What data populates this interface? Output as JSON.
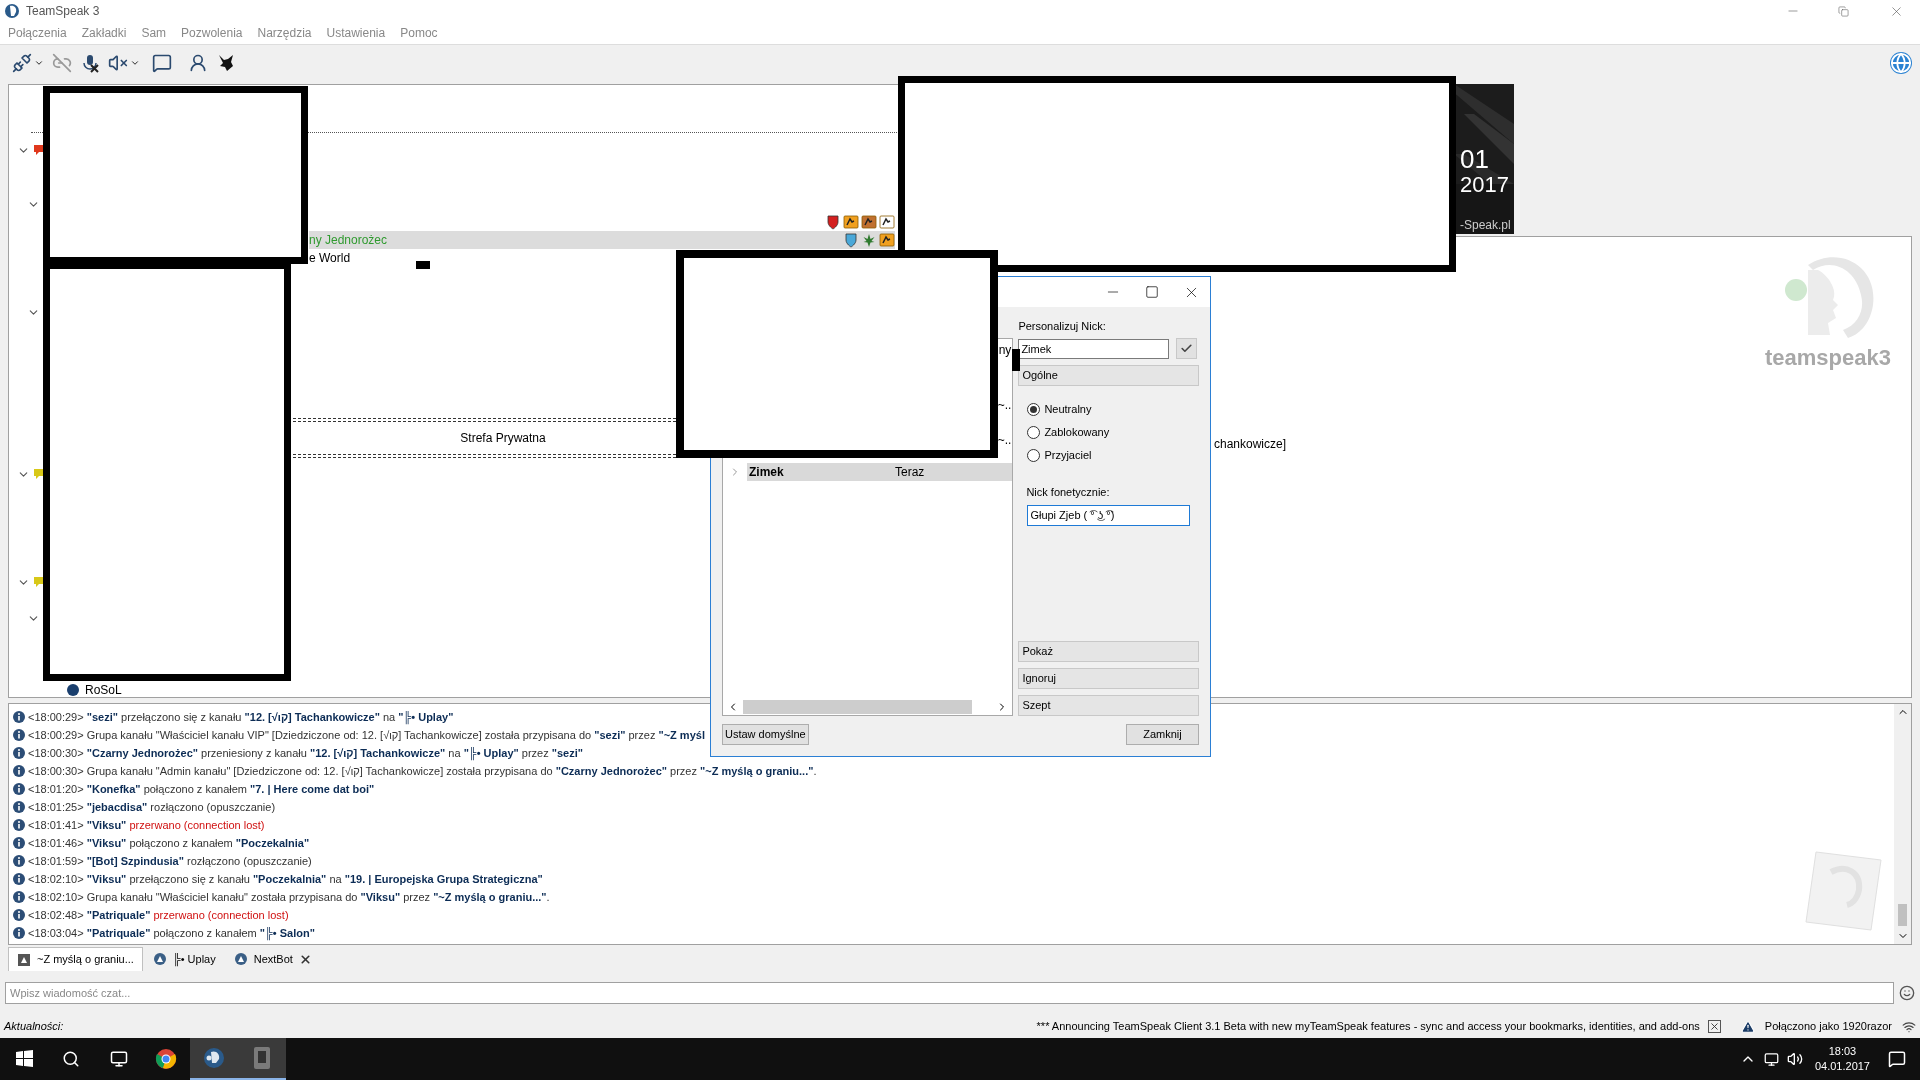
{
  "window": {
    "title": "TeamSpeak 3"
  },
  "menu": [
    "Połączenia",
    "Zakładki",
    "Sam",
    "Pozwolenia",
    "Narzędzia",
    "Ustawienia",
    "Pomoc"
  ],
  "tree": [
    {
      "kind": "dotted-spacer"
    },
    {
      "kind": "channel",
      "expanded": true,
      "color": "#e0381c",
      "children": [
        {
          "kind": "channel",
          "expanded": true,
          "children": [
            {
              "kind": "client"
            },
            {
              "kind": "client",
              "name": "ny Jednorożec",
              "selected": true,
              "color": "#2f9a2f"
            },
            {
              "kind": "client",
              "name": "e World",
              "selected": false,
              "color": "#000000"
            }
          ]
        },
        {
          "kind": "channel",
          "expanded": true
        }
      ]
    },
    {
      "kind": "double-spacer"
    },
    {
      "kind": "title-spacer",
      "name": "Strefa Prywatna"
    },
    {
      "kind": "double-spacer"
    },
    {
      "kind": "channel",
      "expanded": true,
      "color": "#d8c818"
    },
    {
      "kind": "channel",
      "expanded": true,
      "color": "#d8c818",
      "children": [
        {
          "kind": "channel",
          "expanded": true,
          "children": [
            {
              "kind": "client",
              "name": "RoSoL",
              "selected": false,
              "color": "#000000"
            }
          ]
        }
      ]
    }
  ],
  "info": {
    "banner": [
      "01",
      "2017",
      "-Speak.pl"
    ],
    "fragment": "chankowicze]",
    "logo": "teamspeak3"
  },
  "dialog": {
    "label": "Personalizuj Nick:",
    "nick": "Zimek",
    "section": "Ogólne",
    "options": [
      {
        "label": "Neutralny",
        "selected": true
      },
      {
        "label": "Zablokowany",
        "selected": false
      },
      {
        "label": "Przyjaciel",
        "selected": false
      }
    ],
    "phonetic_label": "Nick fonetycznie:",
    "phonetic": "Głupi Zjeb ( ͡° ͜ʖ ͡°)",
    "list": [
      {
        "kind": "fragment",
        "name": "ny"
      },
      {
        "kind": "fragment",
        "name": "~.."
      },
      {
        "kind": "fragment",
        "name": "~.."
      },
      {
        "kind": "contact",
        "name": "Zimek",
        "time": "Teraz",
        "selected": true,
        "expanded": false
      }
    ],
    "actions": [
      "Pokaż",
      "Ignoruj",
      "Szept"
    ],
    "reset": "Ustaw domyślne",
    "close": "Zamknij"
  },
  "log": [
    {
      "time": "<18:00:29>",
      "text": "**\"sezi\"** przełączono się z kanału **\"12. [√ιק] Tachankowicze\"** na **\"╠• Uplay\"**"
    },
    {
      "time": "<18:00:29>",
      "text": "Grupa kanału \"Właściciel kanału VIP\" [Dziedziczone od: 12. [√ιק] Tachankowicze] została przypisana do **\"sezi\"** przez **\"~Z myśl**"
    },
    {
      "time": "<18:00:30>",
      "text": "**\"Czarny Jednorożec\"** przeniesiony z kanału **\"12. [√ιק] Tachankowicze\"** na **\"╠• Uplay\"** przez **\"sezi\"**"
    },
    {
      "time": "<18:00:30>",
      "text": "Grupa kanału \"Admin kanału\" [Dziedziczone od: 12. [√ιק] Tachankowicze] została przypisana do **\"Czarny Jednorożec\"** przez **\"~Z myślą o graniu...\"**."
    },
    {
      "time": "<18:01:20>",
      "text": "**\"Konefka\"** połączono z kanałem **\"7. | Here come dat boi\"**"
    },
    {
      "time": "<18:01:25>",
      "text": "**\"jebacdisa\"** rozłączono (opuszczanie)"
    },
    {
      "time": "<18:01:41>",
      "text": "**\"Viksu\"**",
      "alert": "przerwano (connection lost)"
    },
    {
      "time": "<18:01:46>",
      "text": "**\"Viksu\"** połączono z kanałem **\"Poczekalnia\"**"
    },
    {
      "time": "<18:01:59>",
      "text": "**\"[Bot] Szpindusia\"** rozłączono (opuszczanie)"
    },
    {
      "time": "<18:02:10>",
      "text": "**\"Viksu\"** przełączono się z kanału **\"Poczekalnia\"** na **\"19. | Europejska Grupa Strategiczna\"**"
    },
    {
      "time": "<18:02:10>",
      "text": "Grupa kanału \"Właściciel kanału\" została przypisana do **\"Viksu\"** przez **\"~Z myślą o graniu...\"**."
    },
    {
      "time": "<18:02:48>",
      "text": "**\"Patriquale\"**",
      "alert": "przerwano (connection lost)"
    },
    {
      "time": "<18:03:04>",
      "text": "**\"Patriquale\"** połączono z kanałem **\"╠• Salon\"**"
    }
  ],
  "tabs": [
    {
      "label": "~Z myślą o graniu...",
      "selected": true,
      "closable": false
    },
    {
      "label": "╠• Uplay",
      "selected": false,
      "closable": false
    },
    {
      "label": "NextBot",
      "selected": false,
      "closable": true
    }
  ],
  "chat_input": {
    "placeholder": "Wpisz wiadomość czat..."
  },
  "status_bar": {
    "label": "Aktualności:",
    "news": "*** Announcing TeamSpeak Client 3.1 Beta with new myTeamSpeak features - sync and access your bookmarks, identities, and add-ons",
    "connection": "Połączono jako 1920razor"
  },
  "taskbar": {
    "apps": [
      {
        "kind": "browser",
        "active": false
      },
      {
        "kind": "teamspeak",
        "active": true
      },
      {
        "kind": "game",
        "active": true
      }
    ],
    "time": "18:03",
    "date": "04.01.2017"
  }
}
